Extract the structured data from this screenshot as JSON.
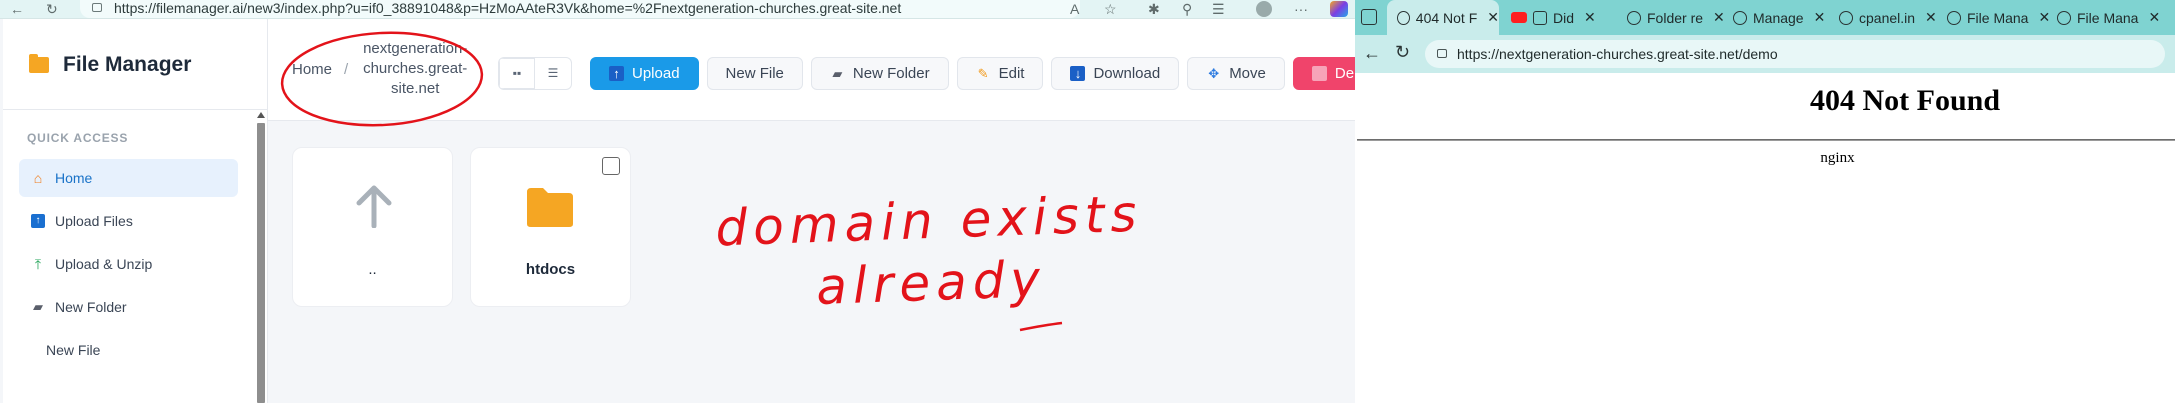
{
  "left_browser": {
    "url": "https://filemanager.ai/new3/index.php?u=if0_38891048&p=HzMoAAteR3Vk&home=%2Fnextgeneration-churches.great-site.net"
  },
  "sidebar": {
    "title": "File Manager",
    "section_label": "QUICK ACCESS",
    "items": [
      {
        "label": "Home",
        "icon": "home-icon"
      },
      {
        "label": "Upload Files",
        "icon": "upload-files-icon"
      },
      {
        "label": "Upload & Unzip",
        "icon": "upload-unzip-icon"
      },
      {
        "label": "New Folder",
        "icon": "new-folder-icon"
      },
      {
        "label": "New File",
        "icon": ""
      }
    ]
  },
  "header": {
    "breadcrumb": {
      "home": "Home",
      "separator": "/",
      "current": "nextgeneration-churches.great-site.net"
    },
    "toolbar": {
      "upload": "Upload",
      "new_file": "New File",
      "new_folder": "New Folder",
      "edit": "Edit",
      "download": "Download",
      "move": "Move",
      "delete": "Delete"
    }
  },
  "files": [
    {
      "name": "..",
      "type": "parent"
    },
    {
      "name": "htdocs",
      "type": "folder"
    }
  ],
  "annotation": {
    "line1": "domain exists",
    "line2": "already",
    "color": "#e3131a"
  },
  "right_browser": {
    "tabs": [
      {
        "label": "404 Not F"
      },
      {
        "label": "Did"
      },
      {
        "label": "Folder re"
      },
      {
        "label": "Manage"
      },
      {
        "label": "cpanel.in"
      },
      {
        "label": "File Mana"
      },
      {
        "label": "File Mana"
      }
    ],
    "url": "https://nextgeneration-churches.great-site.net/demo",
    "page": {
      "heading": "404 Not Found",
      "server": "nginx"
    }
  },
  "colors": {
    "accent": "#1a9ae8",
    "danger": "#f0446b",
    "folder": "#f5a623",
    "browser_chrome": "#7fd3d1"
  }
}
